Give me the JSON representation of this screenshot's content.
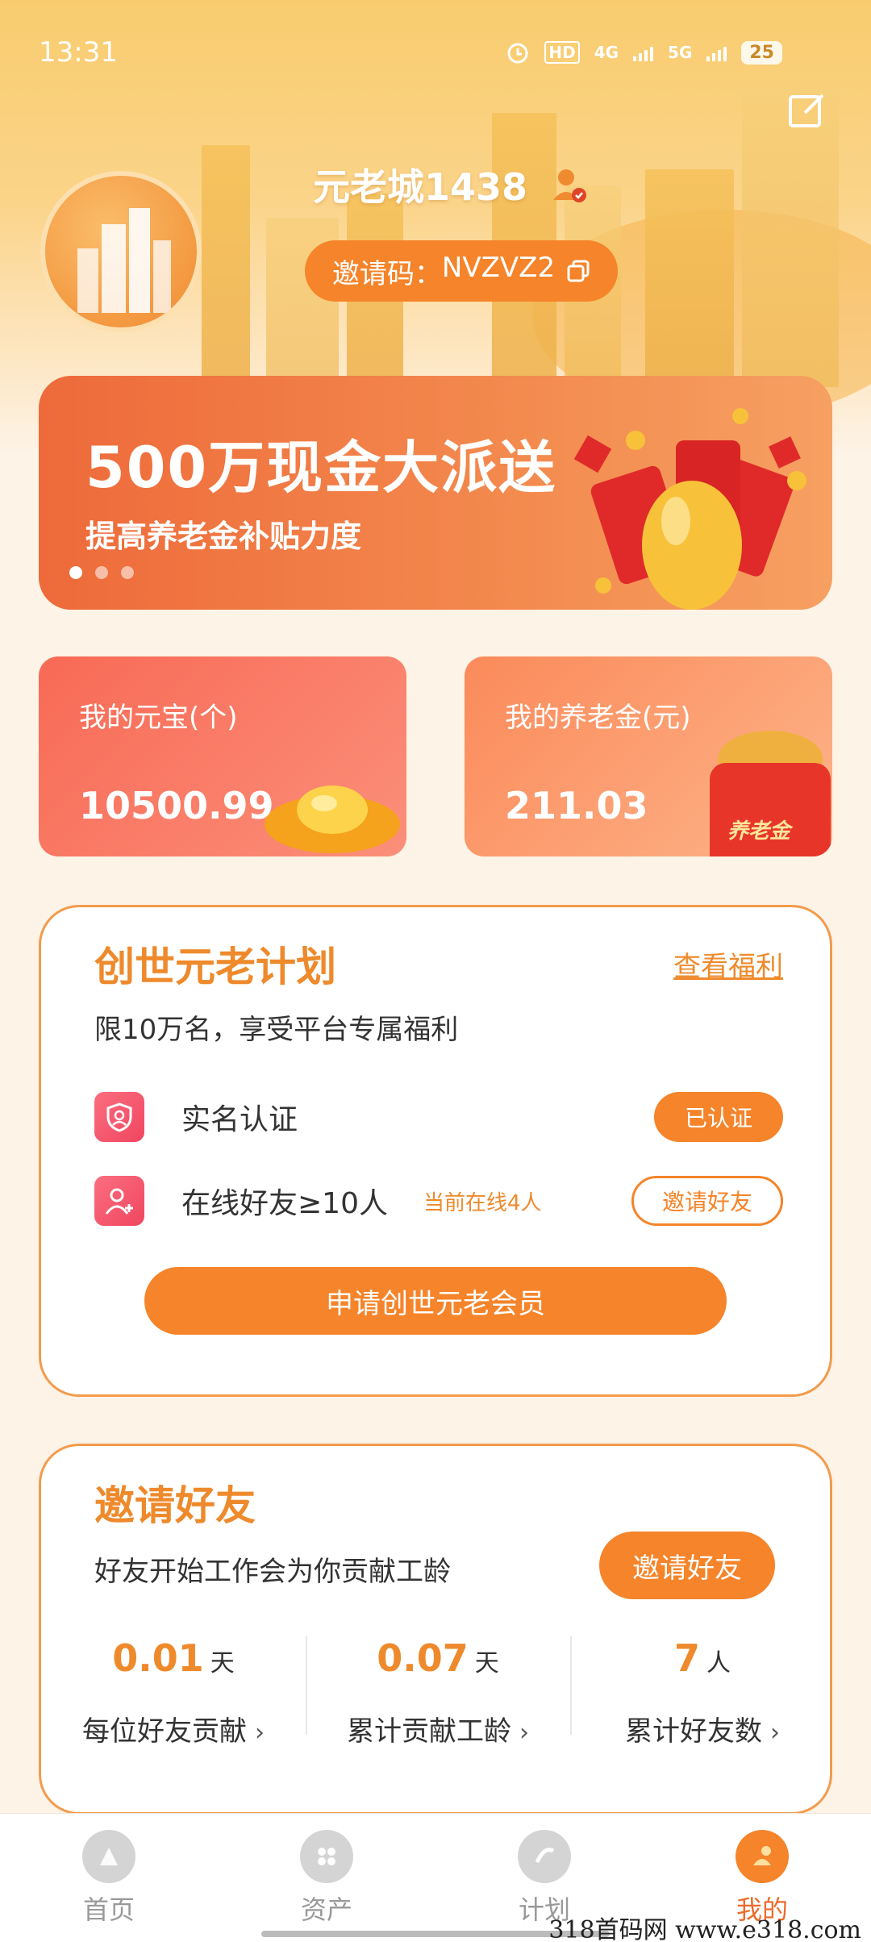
{
  "status_bar": {
    "time": "13:31",
    "battery": "25",
    "net1": "4G",
    "net2": "5G",
    "hd": "HD"
  },
  "profile": {
    "username": "元老城1438",
    "invite_label": "邀请码：",
    "invite_code": "NVZVZ2"
  },
  "banner": {
    "title": "500万现金大派送",
    "subtitle": "提高养老金补贴力度",
    "slides": 3,
    "active_slide": 1
  },
  "assets": {
    "yuanbao": {
      "title": "我的元宝(个)",
      "value": "10500.99"
    },
    "pension": {
      "title": "我的养老金(元)",
      "value": "211.03",
      "tag": "养老金"
    }
  },
  "plan": {
    "title": "创世元老计划",
    "link": "查看福利",
    "desc": "限10万名，享受平台专属福利",
    "rows": [
      {
        "label": "实名认证",
        "hint": "",
        "button": "已认证"
      },
      {
        "label": "在线好友≥10人",
        "hint": "当前在线4人",
        "button": "邀请好友"
      }
    ],
    "apply_button": "申请创世元老会员"
  },
  "invite": {
    "title": "邀请好友",
    "desc": "好友开始工作会为你贡献工龄",
    "button": "邀请好友",
    "stats": [
      {
        "value": "0.01",
        "unit": "天",
        "label": "每位好友贡献"
      },
      {
        "value": "0.07",
        "unit": "天",
        "label": "累计贡献工龄"
      },
      {
        "value": "7",
        "unit": "人",
        "label": "累计好友数"
      }
    ]
  },
  "tabbar": {
    "items": [
      {
        "label": "首页",
        "icon": "home-icon"
      },
      {
        "label": "资产",
        "icon": "assets-icon"
      },
      {
        "label": "计划",
        "icon": "plan-icon"
      },
      {
        "label": "我的",
        "icon": "profile-icon"
      }
    ],
    "active": 3
  },
  "watermark": "318首码网  www.e318.com",
  "colors": {
    "accent": "#f5842a",
    "title_orange": "#ee8a2c",
    "background": "#fdf3e6"
  }
}
